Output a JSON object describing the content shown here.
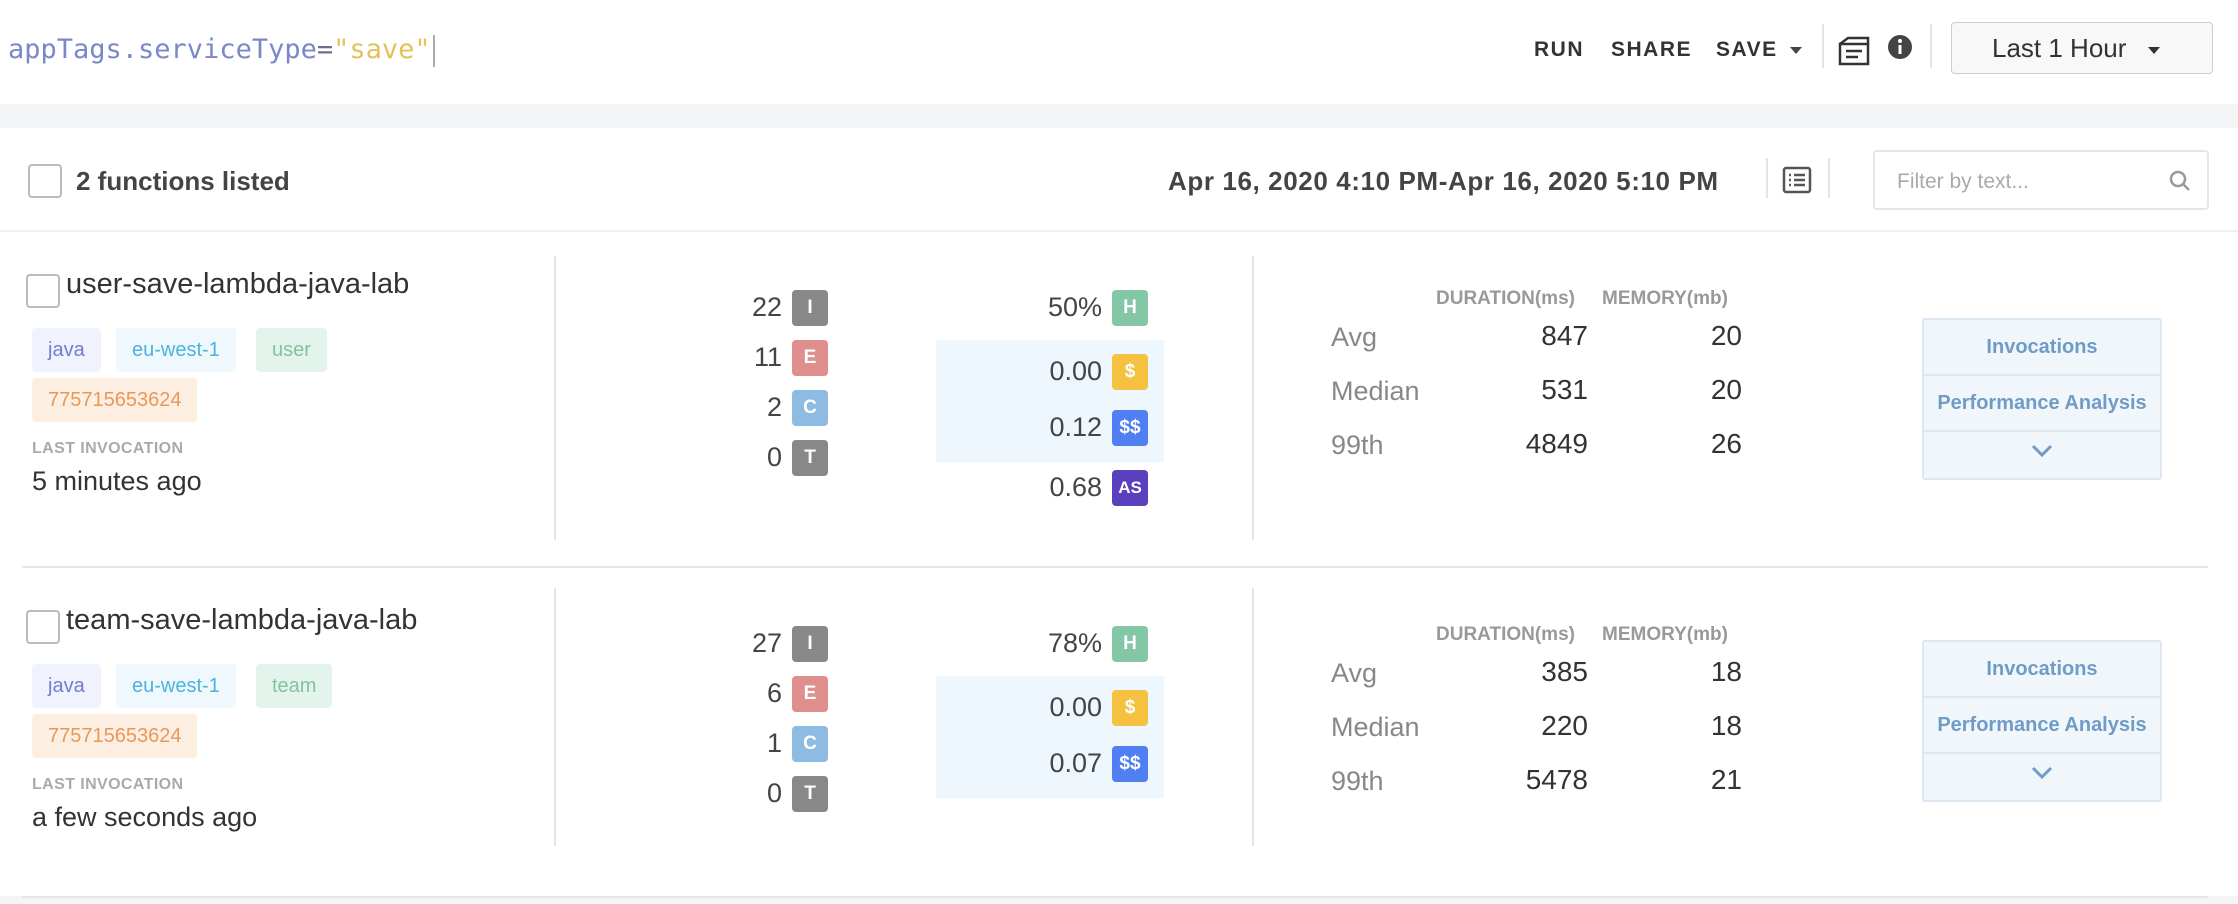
{
  "query": {
    "key": "appTags.serviceType",
    "eq": "=",
    "value": "\"save\""
  },
  "toolbar": {
    "run": "RUN",
    "share": "SHARE",
    "save": "SAVE",
    "time_range": "Last 1 Hour"
  },
  "list": {
    "count_text": "2 functions listed",
    "date_range": "Apr 16, 2020 4:10 PM-Apr 16, 2020 5:10 PM",
    "filter_placeholder": "Filter by text..."
  },
  "columns": {
    "duration": "DURATION(ms)",
    "memory": "MEMORY(mb)",
    "avg": "Avg",
    "median": "Median",
    "p99": "99th",
    "last_invocation": "LAST INVOCATION"
  },
  "actions": {
    "invocations": "Invocations",
    "performance": "Performance Analysis"
  },
  "badges": {
    "i": "I",
    "e": "E",
    "c": "C",
    "t": "T",
    "h": "H",
    "d": "$",
    "dd": "$$",
    "as": "AS"
  },
  "functions": [
    {
      "name": "user-save-lambda-java-lab",
      "tags": [
        "java",
        "eu-west-1",
        "user",
        "775715653624"
      ],
      "last_invocation": "5 minutes ago",
      "invocations": "22",
      "errors": "11",
      "cold_starts": "2",
      "timeouts": "0",
      "health": "50%",
      "cost": "0.00",
      "cost2": "0.12",
      "as": "0.68",
      "duration": {
        "avg": "847",
        "median": "531",
        "p99": "4849"
      },
      "memory": {
        "avg": "20",
        "median": "20",
        "p99": "26"
      }
    },
    {
      "name": "team-save-lambda-java-lab",
      "tags": [
        "java",
        "eu-west-1",
        "team",
        "775715653624"
      ],
      "last_invocation": "a few seconds ago",
      "invocations": "27",
      "errors": "6",
      "cold_starts": "1",
      "timeouts": "0",
      "health": "78%",
      "cost": "0.00",
      "cost2": "0.07",
      "duration": {
        "avg": "385",
        "median": "220",
        "p99": "5478"
      },
      "memory": {
        "avg": "18",
        "median": "18",
        "p99": "21"
      }
    }
  ],
  "colors": {
    "accent": "#6f9cc7",
    "health": "#84c7a4",
    "error": "#e08f8f",
    "cold": "#8ebbe2",
    "cost": "#f4c140",
    "cost2": "#4f7ff2",
    "as": "#5a3fbf"
  }
}
